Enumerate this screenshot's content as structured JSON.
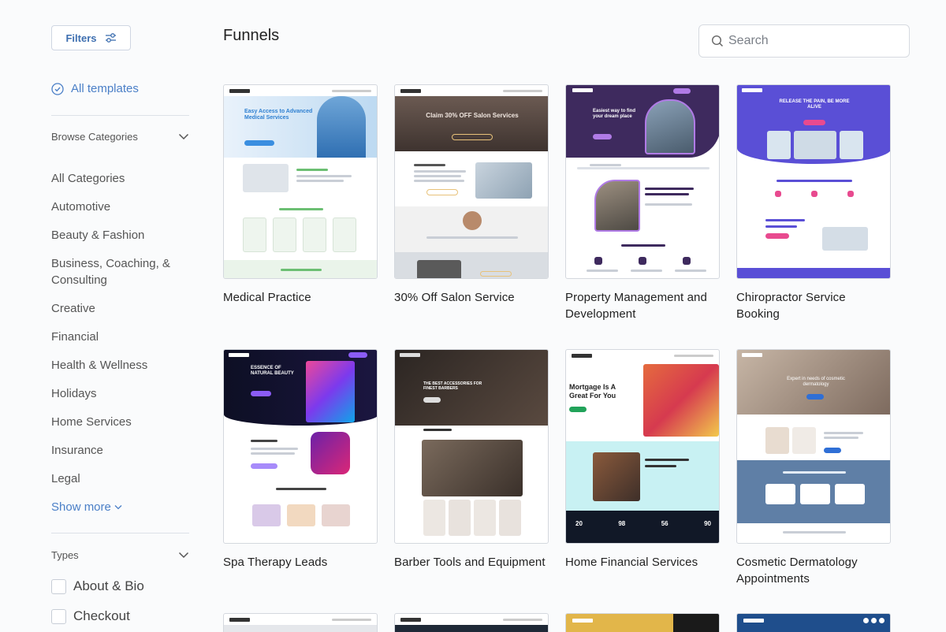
{
  "sidebar": {
    "filters_label": "Filters",
    "all_templates_label": "All templates",
    "browse_heading": "Browse Categories",
    "categories": [
      "All Categories",
      "Automotive",
      "Beauty & Fashion",
      "Business, Coaching, & Consulting",
      "Creative",
      "Financial",
      "Health & Wellness",
      "Holidays",
      "Home Services",
      "Insurance",
      "Legal"
    ],
    "show_more_label": "Show more",
    "types_heading": "Types",
    "types": [
      "About & Bio",
      "Checkout"
    ]
  },
  "main": {
    "title": "Funnels",
    "search": {
      "placeholder": "Search",
      "value": ""
    },
    "cards": [
      {
        "title": "Medical Practice",
        "thumb_text": "Easy Access to Advanced Medical Services"
      },
      {
        "title": "30% Off Salon Service",
        "thumb_text": "Claim 30% OFF Salon Services"
      },
      {
        "title": "Property Management and Development",
        "thumb_text": "Easiest way to find your dream place"
      },
      {
        "title": "Chiropractor Service Booking",
        "thumb_text": "RELEASE THE PAIN, BE MORE ALIVE"
      },
      {
        "title": "Spa Therapy Leads",
        "thumb_text": "ESSENCE OF NATURAL BEAUTY"
      },
      {
        "title": "Barber Tools and Equipment",
        "thumb_text": "THE BEST ACCESSORIES FOR FINEST BARBERS"
      },
      {
        "title": "Home Financial Services",
        "thumb_text": "Mortgage Is A Great For You"
      },
      {
        "title": "Cosmetic Dermatology Appointments",
        "thumb_text": "Expert in needs of cosmetic dermatology"
      }
    ]
  },
  "colors": {
    "accent": "#4a7fc7",
    "border": "#d4d8de",
    "text": "#222222"
  }
}
